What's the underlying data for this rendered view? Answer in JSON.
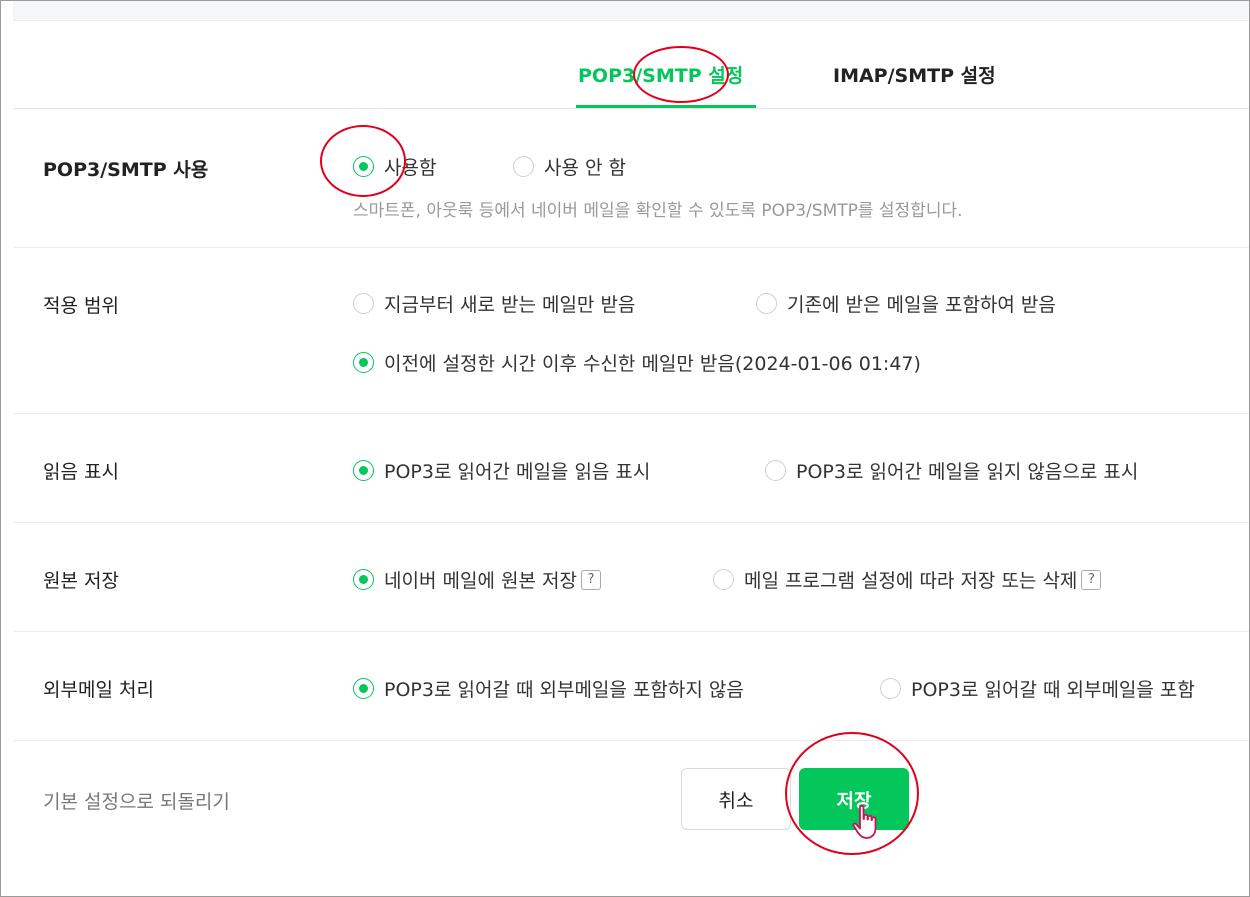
{
  "tabs": [
    {
      "label": "POP3/SMTP 설정",
      "active": true
    },
    {
      "label": "IMAP/SMTP 설정",
      "active": false
    }
  ],
  "settings": {
    "pop3_use": {
      "label": "POP3/SMTP 사용",
      "options": [
        "사용함",
        "사용 안 함"
      ],
      "selected": 0,
      "description": "스마트폰, 아웃룩 등에서 네이버 메일을 확인할 수 있도록 POP3/SMTP를 설정합니다."
    },
    "scope": {
      "label": "적용 범위",
      "options": [
        "지금부터 새로 받는 메일만 받음",
        "기존에 받은 메일을 포함하여 받음",
        "이전에 설정한 시간 이후 수신한 메일만 받음(2024-01-06 01:47)"
      ],
      "selected": 2
    },
    "read_mark": {
      "label": "읽음 표시",
      "options": [
        "POP3로 읽어간 메일을 읽음 표시",
        "POP3로 읽어간 메일을 읽지 않음으로 표시"
      ],
      "selected": 0
    },
    "original_save": {
      "label": "원본 저장",
      "options": [
        "네이버 메일에 원본 저장",
        "메일 프로그램 설정에 따라 저장 또는 삭제"
      ],
      "help_label": "?",
      "selected": 0
    },
    "external_mail": {
      "label": "외부메일 처리",
      "options": [
        "POP3로 읽어갈 때 외부메일을 포함하지 않음",
        "POP3로 읽어갈 때 외부메일을 포함"
      ],
      "selected": 0
    }
  },
  "footer": {
    "reset_label": "기본 설정으로 되돌리기",
    "cancel_label": "취소",
    "save_label": "저장"
  },
  "colors": {
    "accent": "#03c75a",
    "annotation": "#e0001b"
  },
  "icons": [
    "radio-selected-icon",
    "radio-unselected-icon",
    "help-icon",
    "hand-pointer-icon"
  ]
}
